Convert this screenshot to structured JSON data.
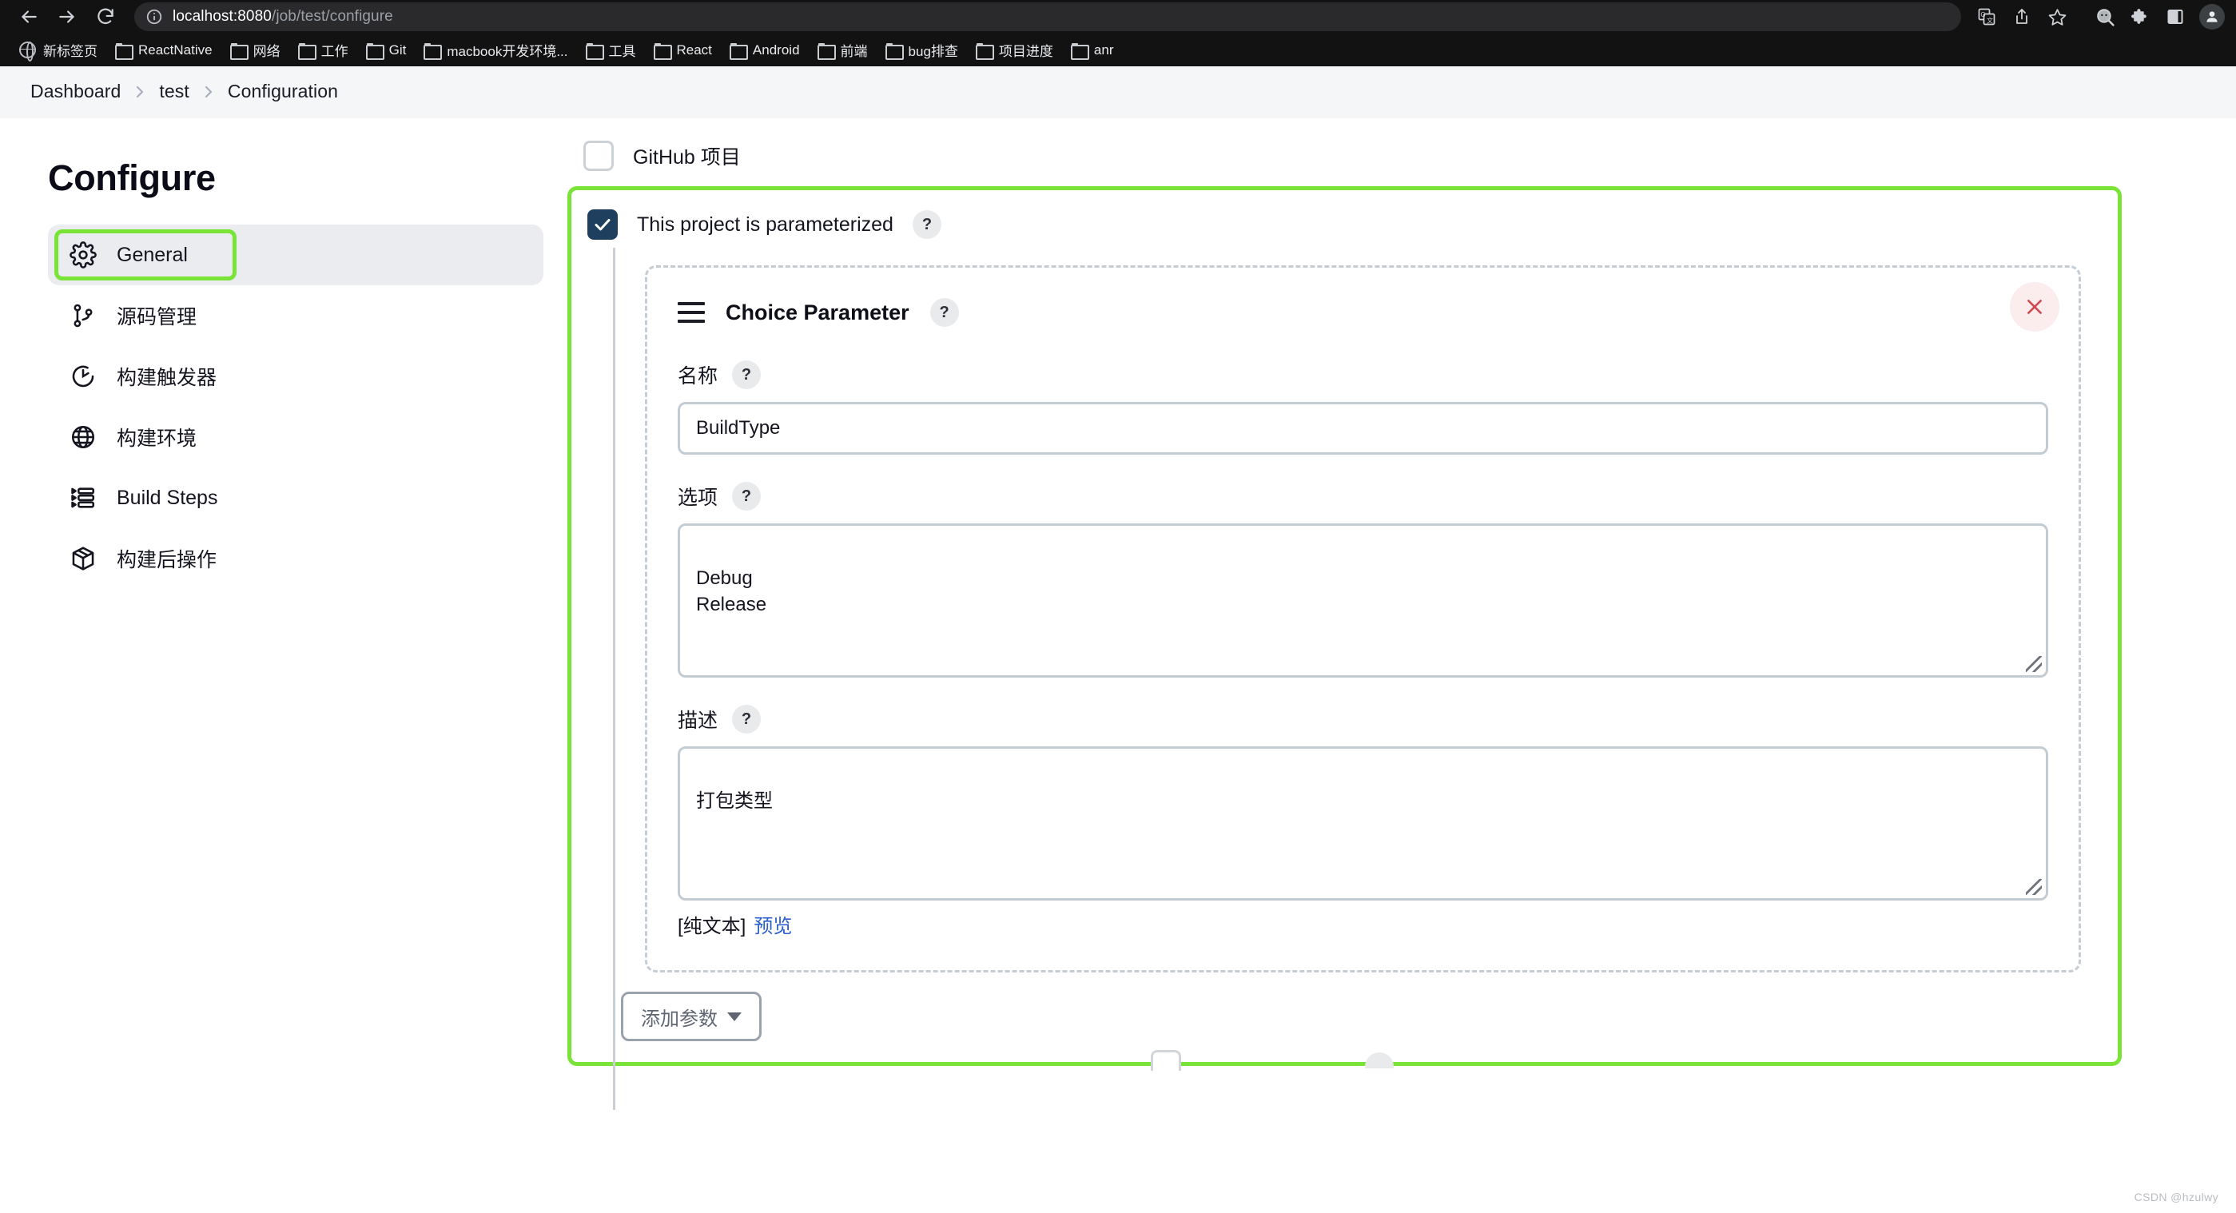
{
  "browser": {
    "back_icon": "back-arrow-icon",
    "forward_icon": "forward-arrow-icon",
    "reload_icon": "reload-icon",
    "url_host": "localhost:8080",
    "url_path": "/job/test/configure",
    "site_info_icon": "info-circle-icon",
    "toolbar_icons": [
      "translate-icon",
      "share-icon",
      "bookmark-star-icon",
      "search-extension-icon",
      "extensions-puzzle-icon",
      "side-panel-icon"
    ],
    "profile_icon": "profile-avatar-icon",
    "bookmarks": [
      {
        "label": "新标签页",
        "icon": "globe-icon"
      },
      {
        "label": "ReactNative",
        "icon": "folder-icon"
      },
      {
        "label": "网络",
        "icon": "folder-icon"
      },
      {
        "label": "工作",
        "icon": "folder-icon"
      },
      {
        "label": "Git",
        "icon": "folder-icon"
      },
      {
        "label": "macbook开发环境...",
        "icon": "folder-icon"
      },
      {
        "label": "工具",
        "icon": "folder-icon"
      },
      {
        "label": "React",
        "icon": "folder-icon"
      },
      {
        "label": "Android",
        "icon": "folder-icon"
      },
      {
        "label": "前端",
        "icon": "folder-icon"
      },
      {
        "label": "bug排查",
        "icon": "folder-icon"
      },
      {
        "label": "项目进度",
        "icon": "folder-icon"
      },
      {
        "label": "anr",
        "icon": "folder-icon"
      }
    ]
  },
  "breadcrumb": {
    "items": [
      "Dashboard",
      "test",
      "Configuration"
    ],
    "separator": "›"
  },
  "sidebar": {
    "title": "Configure",
    "items": [
      {
        "label": "General",
        "icon": "gear-icon",
        "active": true
      },
      {
        "label": "源码管理",
        "icon": "source-branch-icon",
        "active": false
      },
      {
        "label": "构建触发器",
        "icon": "clock-icon",
        "active": false
      },
      {
        "label": "构建环境",
        "icon": "globe-icon",
        "active": false
      },
      {
        "label": "Build Steps",
        "icon": "list-steps-icon",
        "active": false
      },
      {
        "label": "构建后操作",
        "icon": "package-icon",
        "active": false
      }
    ]
  },
  "main": {
    "github_project": {
      "label": "GitHub 项目",
      "checked": false
    },
    "parameterized": {
      "label": "This project is parameterized",
      "checked": true,
      "help": "?"
    },
    "choice_parameter": {
      "title": "Choice Parameter",
      "help": "?",
      "drag_icon": "drag-handle-icon",
      "close_icon": "close-icon",
      "name_field": {
        "label": "名称",
        "help": "?",
        "value": "BuildType",
        "placeholder": ""
      },
      "options_field": {
        "label": "选项",
        "help": "?",
        "value": "Debug\nRelease",
        "placeholder": ""
      },
      "description_field": {
        "label": "描述",
        "help": "?",
        "value": "打包类型",
        "placeholder": ""
      },
      "markup_note": "[纯文本]",
      "preview_link": "预览"
    },
    "add_parameter_button": {
      "label": "添加参数",
      "caret": "chevron-down-icon"
    }
  },
  "colors": {
    "highlight_green": "#7ae338",
    "checkbox_navy": "#1e3f5e",
    "link_blue": "#2c5fcb",
    "close_red": "#cf4b51",
    "dashed_border": "#c5ccd3"
  },
  "watermark": "CSDN @hzulwy"
}
